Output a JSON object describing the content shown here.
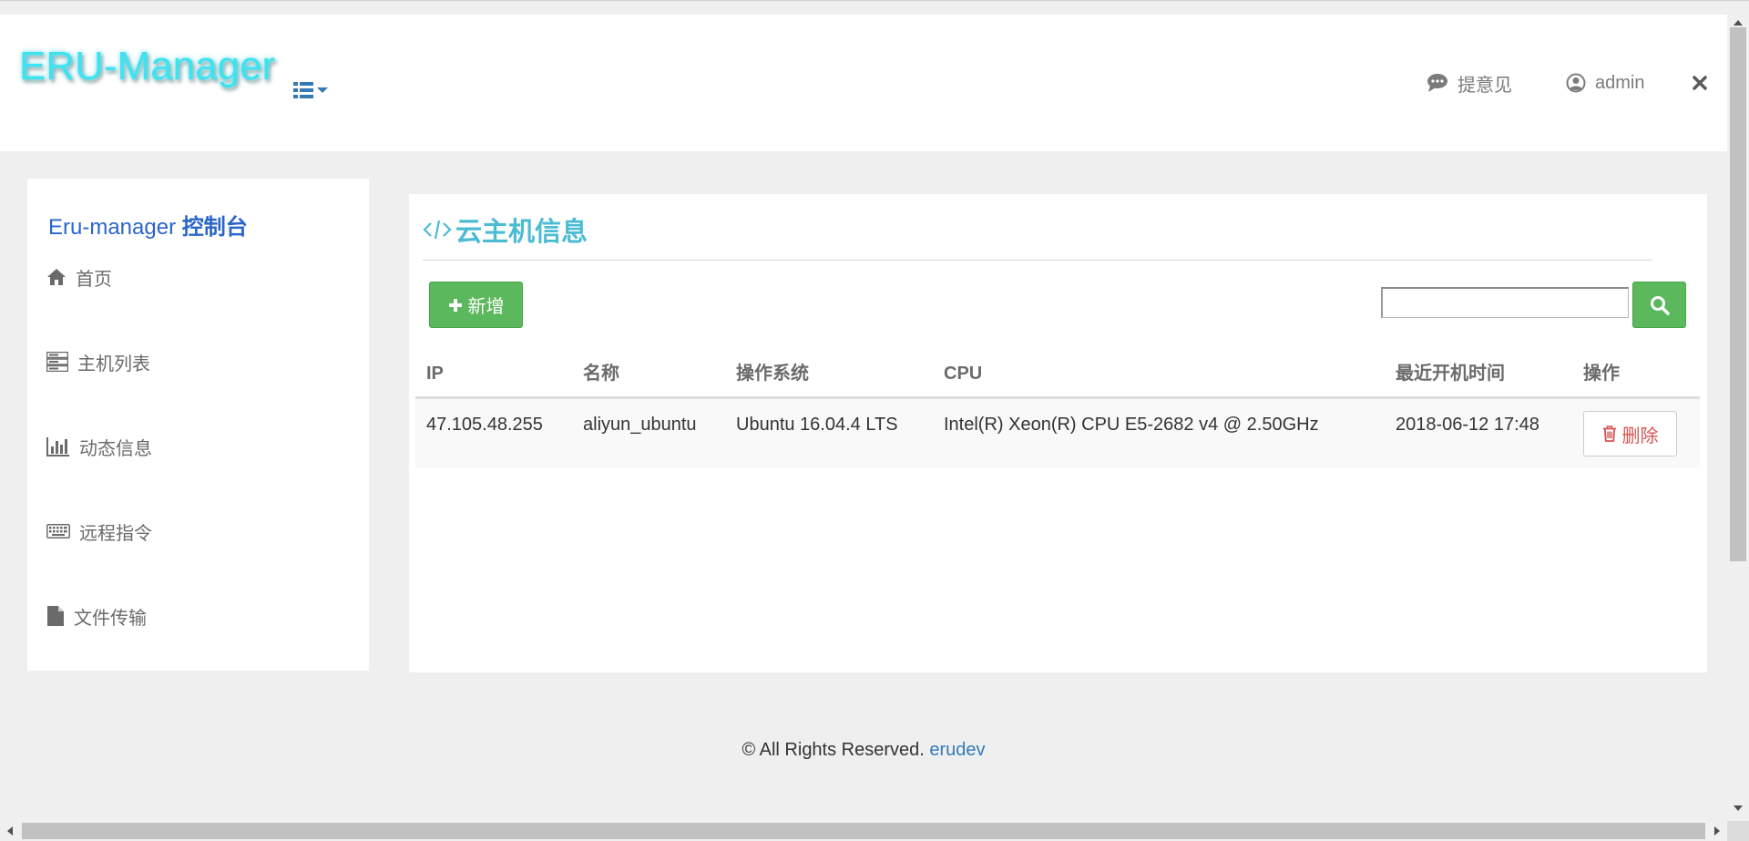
{
  "header": {
    "logo": "ERU-Manager",
    "feedback_label": "提意见",
    "user_label": "admin"
  },
  "sidebar": {
    "title_prefix": "Eru-manager",
    "title_strong": "控制台",
    "items": [
      {
        "label": "首页",
        "icon": "home-icon"
      },
      {
        "label": "主机列表",
        "icon": "server-icon"
      },
      {
        "label": "动态信息",
        "icon": "bar-chart-icon"
      },
      {
        "label": "远程指令",
        "icon": "keyboard-icon"
      },
      {
        "label": "文件传输",
        "icon": "file-icon"
      }
    ]
  },
  "main": {
    "title": "云主机信息",
    "add_label": "新增",
    "search_placeholder": "",
    "table": {
      "columns": [
        "IP",
        "名称",
        "操作系统",
        "CPU",
        "最近开机时间",
        "操作"
      ],
      "rows": [
        {
          "ip": "47.105.48.255",
          "name": "aliyun_ubuntu",
          "os": "Ubuntu 16.04.4 LTS",
          "cpu": "Intel(R) Xeon(R) CPU E5-2682 v4 @ 2.50GHz",
          "boot_time": "2018-06-12 17:48",
          "action_label": "删除"
        }
      ]
    }
  },
  "footer": {
    "text": "© All Rights Reserved.",
    "link": "erudev"
  },
  "colors": {
    "accent_green": "#5cb85c",
    "title_cyan": "#4bbcd4",
    "link_blue": "#337ab7",
    "sidebar_title_blue": "#2a66c9",
    "danger_red": "#d9534f",
    "logo_cyan": "#3ce3f0"
  }
}
